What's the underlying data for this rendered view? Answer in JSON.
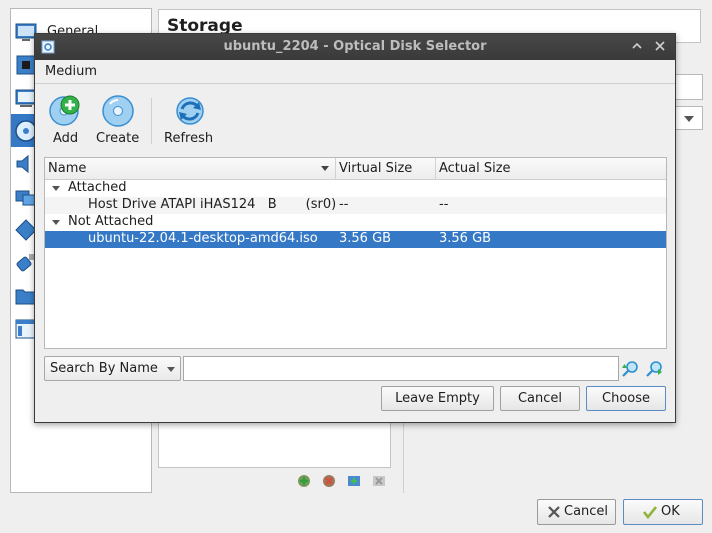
{
  "background": {
    "sidebar": {
      "items": [
        {
          "label": "General",
          "icon": "general-settings-icon"
        },
        {
          "label": "",
          "icon": "system-chip-icon"
        },
        {
          "label": "",
          "icon": "display-monitor-icon"
        },
        {
          "label": "",
          "icon": "storage-disc-icon",
          "selected": true
        },
        {
          "label": "",
          "icon": "audio-speaker-icon"
        },
        {
          "label": "",
          "icon": "network-icon"
        },
        {
          "label": "",
          "icon": "serial-port-icon"
        },
        {
          "label": "",
          "icon": "usb-icon"
        },
        {
          "label": "",
          "icon": "shared-folder-icon"
        },
        {
          "label": "",
          "icon": "user-interface-icon"
        }
      ]
    },
    "section_title": "Storage",
    "storage_toolbar_icons": [
      "add-attachment-icon",
      "remove-attachment-icon",
      "add-controller-icon",
      "remove-controller-icon"
    ],
    "buttons": {
      "cancel": "Cancel",
      "ok": "OK"
    }
  },
  "dialog": {
    "title": "ubuntu_2204 - Optical Disk Selector",
    "menu": {
      "medium": "Medium"
    },
    "toolbar": {
      "add": "Add",
      "create": "Create",
      "refresh": "Refresh"
    },
    "table": {
      "columns": [
        "Name",
        "Virtual Size",
        "Actual Size"
      ],
      "groups": [
        {
          "label": "Attached",
          "items": [
            {
              "name": "Host Drive ATAPI iHAS124   B       (sr0)",
              "virtual_size": "--",
              "actual_size": "--"
            }
          ]
        },
        {
          "label": "Not Attached",
          "items": [
            {
              "name": "ubuntu-22.04.1-desktop-amd64.iso",
              "virtual_size": "3.56 GB",
              "actual_size": "3.56 GB",
              "selected": true
            }
          ]
        }
      ]
    },
    "search": {
      "mode": "Search By Name",
      "value": ""
    },
    "buttons": {
      "leave_empty": "Leave Empty",
      "cancel": "Cancel",
      "choose": "Choose"
    },
    "colors": {
      "selection": "#3478c6",
      "titlebar": "#3d3d3d",
      "add_green": "#33b24a",
      "icon_blue": "#3a9be0"
    }
  }
}
